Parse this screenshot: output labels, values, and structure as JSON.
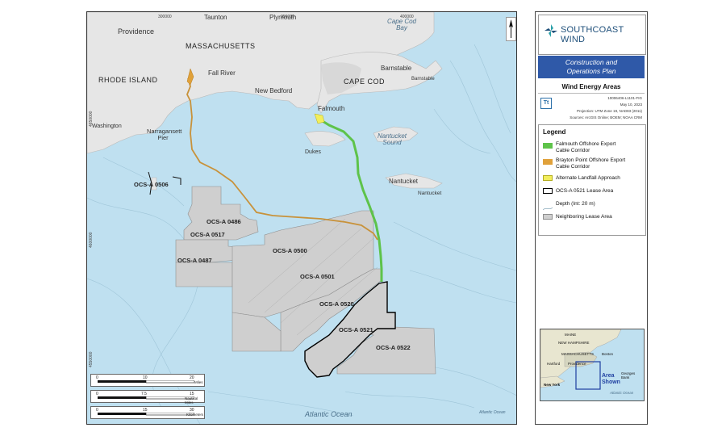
{
  "map": {
    "places": {
      "providence": "Providence",
      "taunton": "Taunton",
      "plymouth": "Plymouth",
      "cape_cod_bay": "Cape Cod Bay",
      "massachusetts": "MASSACHUSETTS",
      "rhode_island": "RHODE ISLAND",
      "fall_river": "Fall River",
      "new_bedford": "New Bedford",
      "barnstable": "Barnstable",
      "barnstable_2": "Barnstable",
      "cape_cod": "CAPE COD",
      "falmouth": "Falmouth",
      "washington": "Washington",
      "narragansett_pier": "Narragansett Pier",
      "dukes": "Dukes",
      "nantucket_sound": "Nantucket Sound",
      "nantucket": "Nantucket",
      "nantucket_2": "Nantucket",
      "atlantic_ocean": "Atlantic Ocean",
      "atlantic_ocean_small": "Atlantic Ocean"
    },
    "leases": {
      "a0506": "OCS-A 0506",
      "a0486": "OCS-A 0486",
      "a0517": "OCS-A 0517",
      "a0487": "OCS-A 0487",
      "a0500": "OCS-A 0500",
      "a0501": "OCS-A 0501",
      "a0520": "OCS-A 0520",
      "a0521": "OCS-A 0521",
      "a0522": "OCS-A 0522"
    },
    "coords_top": [
      "300000",
      "350000",
      "400000"
    ],
    "coords_left": [
      "4650000",
      "4600000",
      "4550000"
    ],
    "scalebars": [
      {
        "ticks": [
          "0",
          "10",
          "20"
        ],
        "unit": "Miles"
      },
      {
        "ticks": [
          "0",
          "7.5",
          "15"
        ],
        "unit": "Nautical Miles"
      },
      {
        "ticks": [
          "0",
          "15",
          "30"
        ],
        "unit": "Kilometers"
      }
    ]
  },
  "panel": {
    "brand": "SOUTHCOAST WIND",
    "plan_line1": "Construction and",
    "plan_line2": "Operations Plan",
    "figure_title": "Wind Energy Areas",
    "meta": [
      "10006406-L1101-FIG",
      "May 10, 2023",
      "Projection: UTM Zone 19, NAD83 (2011)",
      "Sources: ArcGIS Online; BOEM; NOAA CRM"
    ],
    "tt_mark": "Tt",
    "legend": {
      "title": "Legend",
      "items": [
        {
          "label_line1": "Falmouth Offshore Export",
          "label_line2": "Cable Corridor",
          "color": "#5ec34a"
        },
        {
          "label_line1": "Brayton Point Offshore Export",
          "label_line2": "Cable Corridor",
          "color": "#e0a13a"
        },
        {
          "label_line1": "Alternate Landfall Approach",
          "label_line2": "",
          "color": "#f2ee5c"
        },
        {
          "label_line1": "OCS-A 0521 Lease Area",
          "label_line2": "",
          "color": "#000000"
        },
        {
          "label_line1": "Depth (Int: 20 m)",
          "label_line2": "",
          "color": "#8aaabb"
        },
        {
          "label_line1": "Neighboring Lease Area",
          "label_line2": "",
          "color": "#cfcfcf"
        }
      ]
    },
    "inset": {
      "maine": "MAINE",
      "new_hampshire": "NEW HAMPSHIRE",
      "massachusetts": "MASSACHUSETTS",
      "boston": "Boston",
      "hartford": "Hartford",
      "providence": "Providence",
      "new_york": "New York",
      "area_shown_1": "Area",
      "area_shown_2": "Shown",
      "georges_bank": "Georges Bank",
      "atlantic_ocean": "Atlantic Ocean"
    }
  },
  "colors": {
    "water": "#bfe0f0",
    "land": "#e6e6e6",
    "lease": "#cfcfcf",
    "falmouth_cable": "#5ec34a",
    "brayton_cable": "#c8923a",
    "landfall": "#f2ee5c",
    "brand_blue": "#2f59a8"
  },
  "icons": [
    "north-arrow-icon",
    "southcoast-wind-logo-icon",
    "tetra-tech-logo-icon"
  ]
}
